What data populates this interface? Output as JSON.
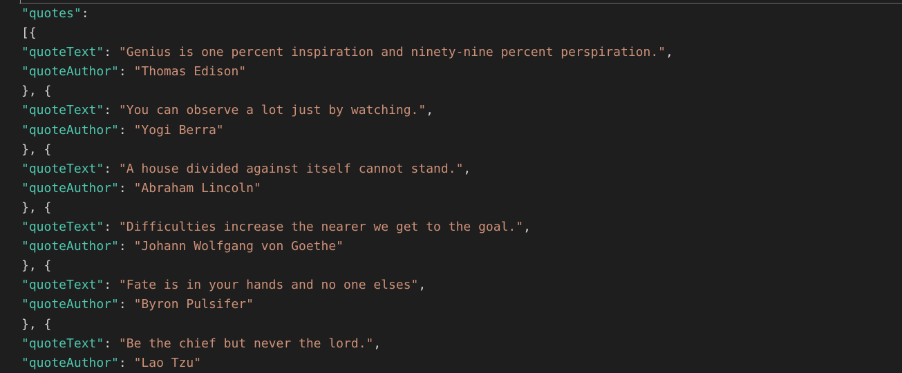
{
  "editor": {
    "root_key": "\"quotes\"",
    "array_open": "[{",
    "separator": "}, {",
    "text_key": "\"quoteText\"",
    "author_key": "\"quoteAuthor\"",
    "quotes": [
      {
        "text": "\"Genius is one percent inspiration and ninety-nine percent perspiration.\"",
        "author": "\"Thomas Edison\""
      },
      {
        "text": "\"You can observe a lot just by watching.\"",
        "author": "\"Yogi Berra\""
      },
      {
        "text": "\"A house divided against itself cannot stand.\"",
        "author": "\"Abraham Lincoln\""
      },
      {
        "text": "\"Difficulties increase the nearer we get to the goal.\"",
        "author": "\"Johann Wolfgang von Goethe\""
      },
      {
        "text": "\"Fate is in your hands and no one elses\"",
        "author": "\"Byron Pulsifer\""
      },
      {
        "text": "\"Be the chief but never the lord.\"",
        "author": "\"Lao Tzu\""
      }
    ]
  }
}
